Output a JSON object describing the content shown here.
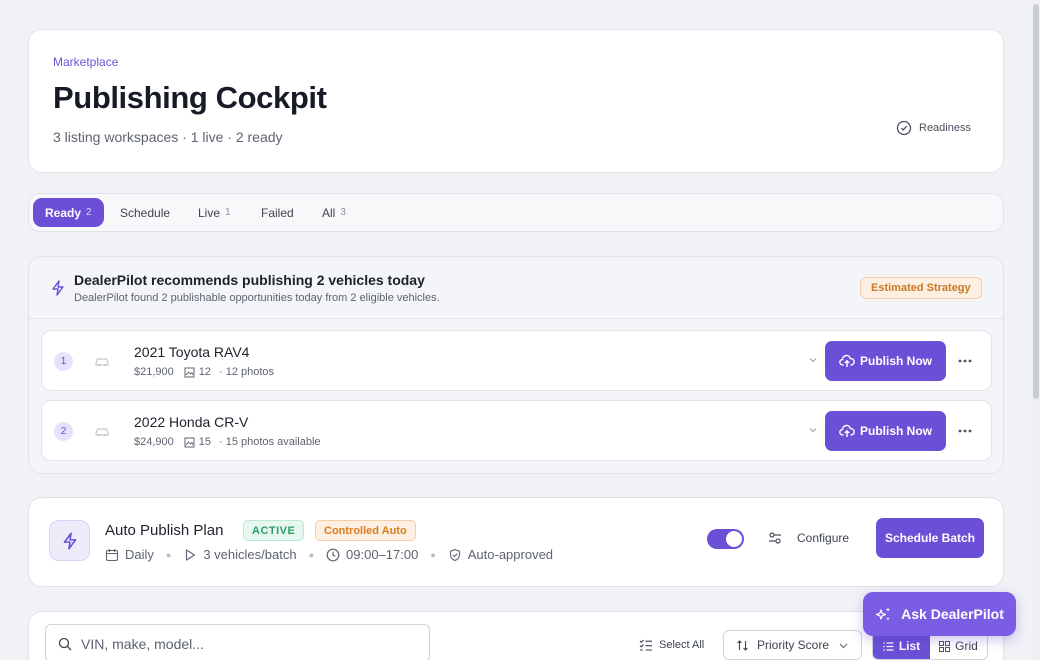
{
  "header": {
    "eyebrow": "Marketplace",
    "title": "Publishing Cockpit",
    "subtitle": "3 listing workspaces · 1 live · 2 ready",
    "readiness_label": "Readiness"
  },
  "tabs": [
    {
      "label": "Ready",
      "count": "2",
      "active": true
    },
    {
      "label": "Schedule",
      "count": ""
    },
    {
      "label": "Live",
      "count": "1"
    },
    {
      "label": "Failed",
      "count": ""
    },
    {
      "label": "All",
      "count": "3"
    }
  ],
  "recommendation": {
    "title": "DealerPilot recommends publishing 2 vehicles today",
    "description": "DealerPilot found 2 publishable opportunities today from 2 eligible vehicles.",
    "strategy_badge": "Estimated Strategy",
    "vehicles": [
      {
        "rank": "1",
        "name": "2021 Toyota RAV4",
        "price": "$21,900",
        "photo_count": "12",
        "photos_text": "· 12 photos",
        "publish_label": "Publish Now"
      },
      {
        "rank": "2",
        "name": "2022 Honda CR-V",
        "price": "$24,900",
        "photo_count": "15",
        "photos_text": "· 15 photos available",
        "publish_label": "Publish Now"
      }
    ]
  },
  "plan": {
    "title": "Auto Publish Plan",
    "status_badge": "ACTIVE",
    "mode_badge": "Controlled Auto",
    "frequency": "Daily",
    "batch": "3 vehicles/batch",
    "window": "09:00–17:00",
    "approval": "Auto-approved",
    "enabled": true,
    "configure_label": "Configure",
    "schedule_label": "Schedule Batch"
  },
  "list": {
    "search_placeholder": "VIN, make, model...",
    "select_all_label": "Select All",
    "sort_value": "Priority Score",
    "view_list_label": "List",
    "view_grid_label": "Grid"
  },
  "assistant": {
    "label": "Ask DealerPilot"
  },
  "colors": {
    "accent": "#6b4fd6",
    "success": "#2e9e65",
    "warning": "#d87d1e"
  }
}
